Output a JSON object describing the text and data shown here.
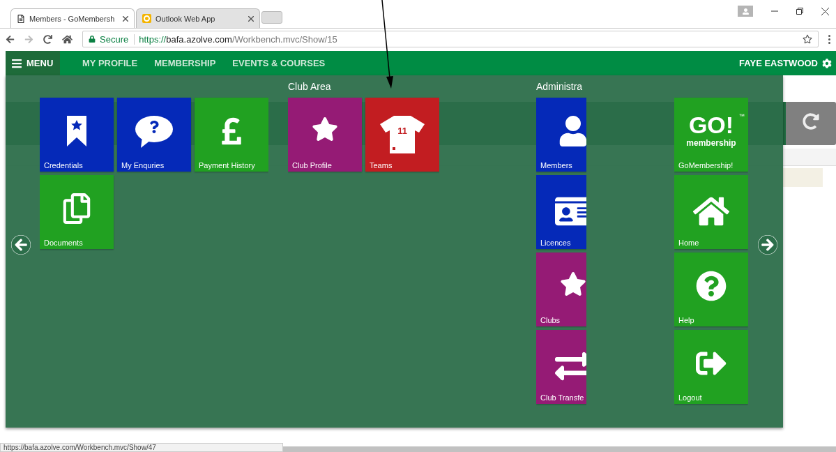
{
  "browser": {
    "tabs": [
      {
        "title": "Members - GoMembersh",
        "selected": true,
        "kind": "page"
      },
      {
        "title": "Outlook Web App",
        "selected": false,
        "kind": "outlook"
      }
    ],
    "address": {
      "secure_label": "Secure",
      "scheme": "https://",
      "host": "bafa.azolve.com",
      "path": "/Workbench.mvc/Show/15"
    }
  },
  "nav": {
    "menu_label": "MENU",
    "items": [
      "MY PROFILE",
      "MEMBERSHIP",
      "EVENTS & COURSES"
    ],
    "user": "FAYE EASTWOOD"
  },
  "menu_overlay": {
    "groups": [
      {
        "tiles": [
          {
            "label": "Credentials",
            "kind": "bookmark",
            "color": "#0529b8"
          },
          {
            "label": "My Enquries",
            "kind": "enquiry",
            "color": "#0529b8"
          },
          {
            "label": "Payment History",
            "kind": "pound",
            "color": "#21a121"
          },
          {
            "label": "Documents",
            "kind": "documents",
            "color": "#21a121"
          }
        ]
      },
      {
        "heading": "Club Area",
        "tiles": [
          {
            "label": "Club Profile",
            "kind": "star",
            "color": "#951b75"
          },
          {
            "label": "Teams",
            "kind": "shirt",
            "shirt_number": "11",
            "color": "#c21d21"
          }
        ]
      },
      {
        "heading": "Administra",
        "clipped": true,
        "tiles": [
          {
            "label": "Members",
            "kind": "user",
            "color": "#0529b8"
          },
          {
            "label": "Licences",
            "kind": "card",
            "color": "#0529b8"
          },
          {
            "label": "Clubs",
            "kind": "star",
            "color": "#951b75"
          },
          {
            "label": "Club Transfe",
            "kind": "transfer",
            "color": "#951b75"
          }
        ]
      },
      {
        "tiles": [
          {
            "label": "GoMembership!",
            "kind": "logo",
            "logo": {
              "main": "GO!",
              "sub": "membership",
              "mark": "™"
            },
            "color": "#21a121"
          },
          {
            "label": "Home",
            "kind": "home",
            "color": "#21a121"
          },
          {
            "label": "Help",
            "kind": "help",
            "color": "#21a121"
          },
          {
            "label": "Logout",
            "kind": "logout",
            "color": "#21a121"
          }
        ]
      }
    ]
  },
  "status_url": "https://bafa.azolve.com/Workbench.mvc/Show/47"
}
